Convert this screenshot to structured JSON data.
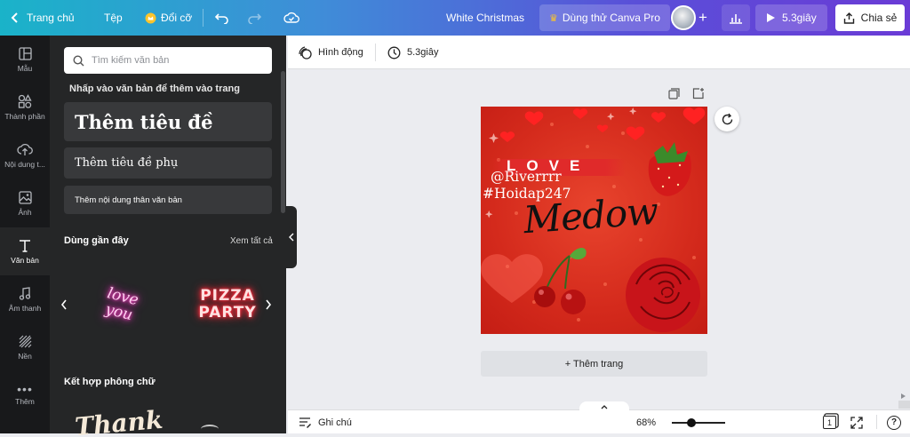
{
  "topbar": {
    "home": "Trang chủ",
    "file": "Tệp",
    "resize": "Đổi cỡ",
    "doc_title": "White Christmas",
    "canva_pro": "Dùng thử Canva Pro",
    "play_duration": "5.3giây",
    "share": "Chia sẻ"
  },
  "rail": {
    "items": [
      {
        "label": "Mẫu"
      },
      {
        "label": "Thành phần"
      },
      {
        "label": "Nội dung t..."
      },
      {
        "label": "Ảnh"
      },
      {
        "label": "Văn bản"
      },
      {
        "label": "Âm thanh"
      },
      {
        "label": "Nền"
      },
      {
        "label": "Thêm"
      }
    ]
  },
  "panel": {
    "search_placeholder": "Tìm kiếm văn bản",
    "hint": "Nhấp vào văn bản để thêm vào trang",
    "add_heading": "Thêm tiêu đề",
    "add_subheading": "Thêm tiêu đề phụ",
    "add_body": "Thêm nội dung thân văn bản",
    "recent_title": "Dùng gần đây",
    "see_all": "Xem tất cả",
    "recent_items": [
      "love you",
      "PIZZA PARTY"
    ],
    "combos_title": "Kết hợp phông chữ",
    "combo_preview": "Thank"
  },
  "context_bar": {
    "animate": "Hình động",
    "duration": "5.3giây"
  },
  "design": {
    "love": "LOVE",
    "handle": "@Riverrrr",
    "hashtag": "#Hoidap247",
    "script": "Medow"
  },
  "canvas": {
    "add_page": "+ Thêm trang"
  },
  "footer": {
    "notes": "Ghi chú",
    "zoom": "68%",
    "zoom_level": 0.68,
    "page_number": "1"
  },
  "colors": {
    "brand_start": "#1ab3c9",
    "brand_end": "#6a3bd6",
    "panel_bg": "#252627",
    "rail_bg": "#18191b",
    "design_red": "#d42a1c"
  }
}
